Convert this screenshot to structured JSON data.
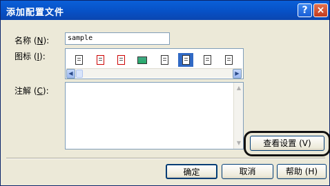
{
  "window": {
    "title": "添加配置文件",
    "help_glyph": "?",
    "close_glyph": "×"
  },
  "name": {
    "label_pre": "名称 (",
    "label_key": "N",
    "label_post": "):",
    "value": "sample"
  },
  "icon": {
    "label_pre": "图标 (",
    "label_key": "I",
    "label_post": "):",
    "items": [
      "doc-lines",
      "doc-red",
      "doc-graphic",
      "image",
      "doc-plain",
      "doc-grid-selected",
      "doc-pen",
      "doc-text"
    ],
    "scroll_left": "◀",
    "scroll_right": "▶"
  },
  "notes": {
    "label_pre": "注解 (",
    "label_key": "C",
    "label_post": "):",
    "value": "",
    "scroll_up": "▲",
    "scroll_down": "▼"
  },
  "buttons": {
    "view_settings": "查看设置 (V)",
    "ok": "确定",
    "cancel": "取消",
    "help": "帮助 (H)"
  },
  "colors": {
    "titlebar": "#0751c6",
    "dialog_bg": "#ece9d8",
    "selection": "#316ac5"
  }
}
